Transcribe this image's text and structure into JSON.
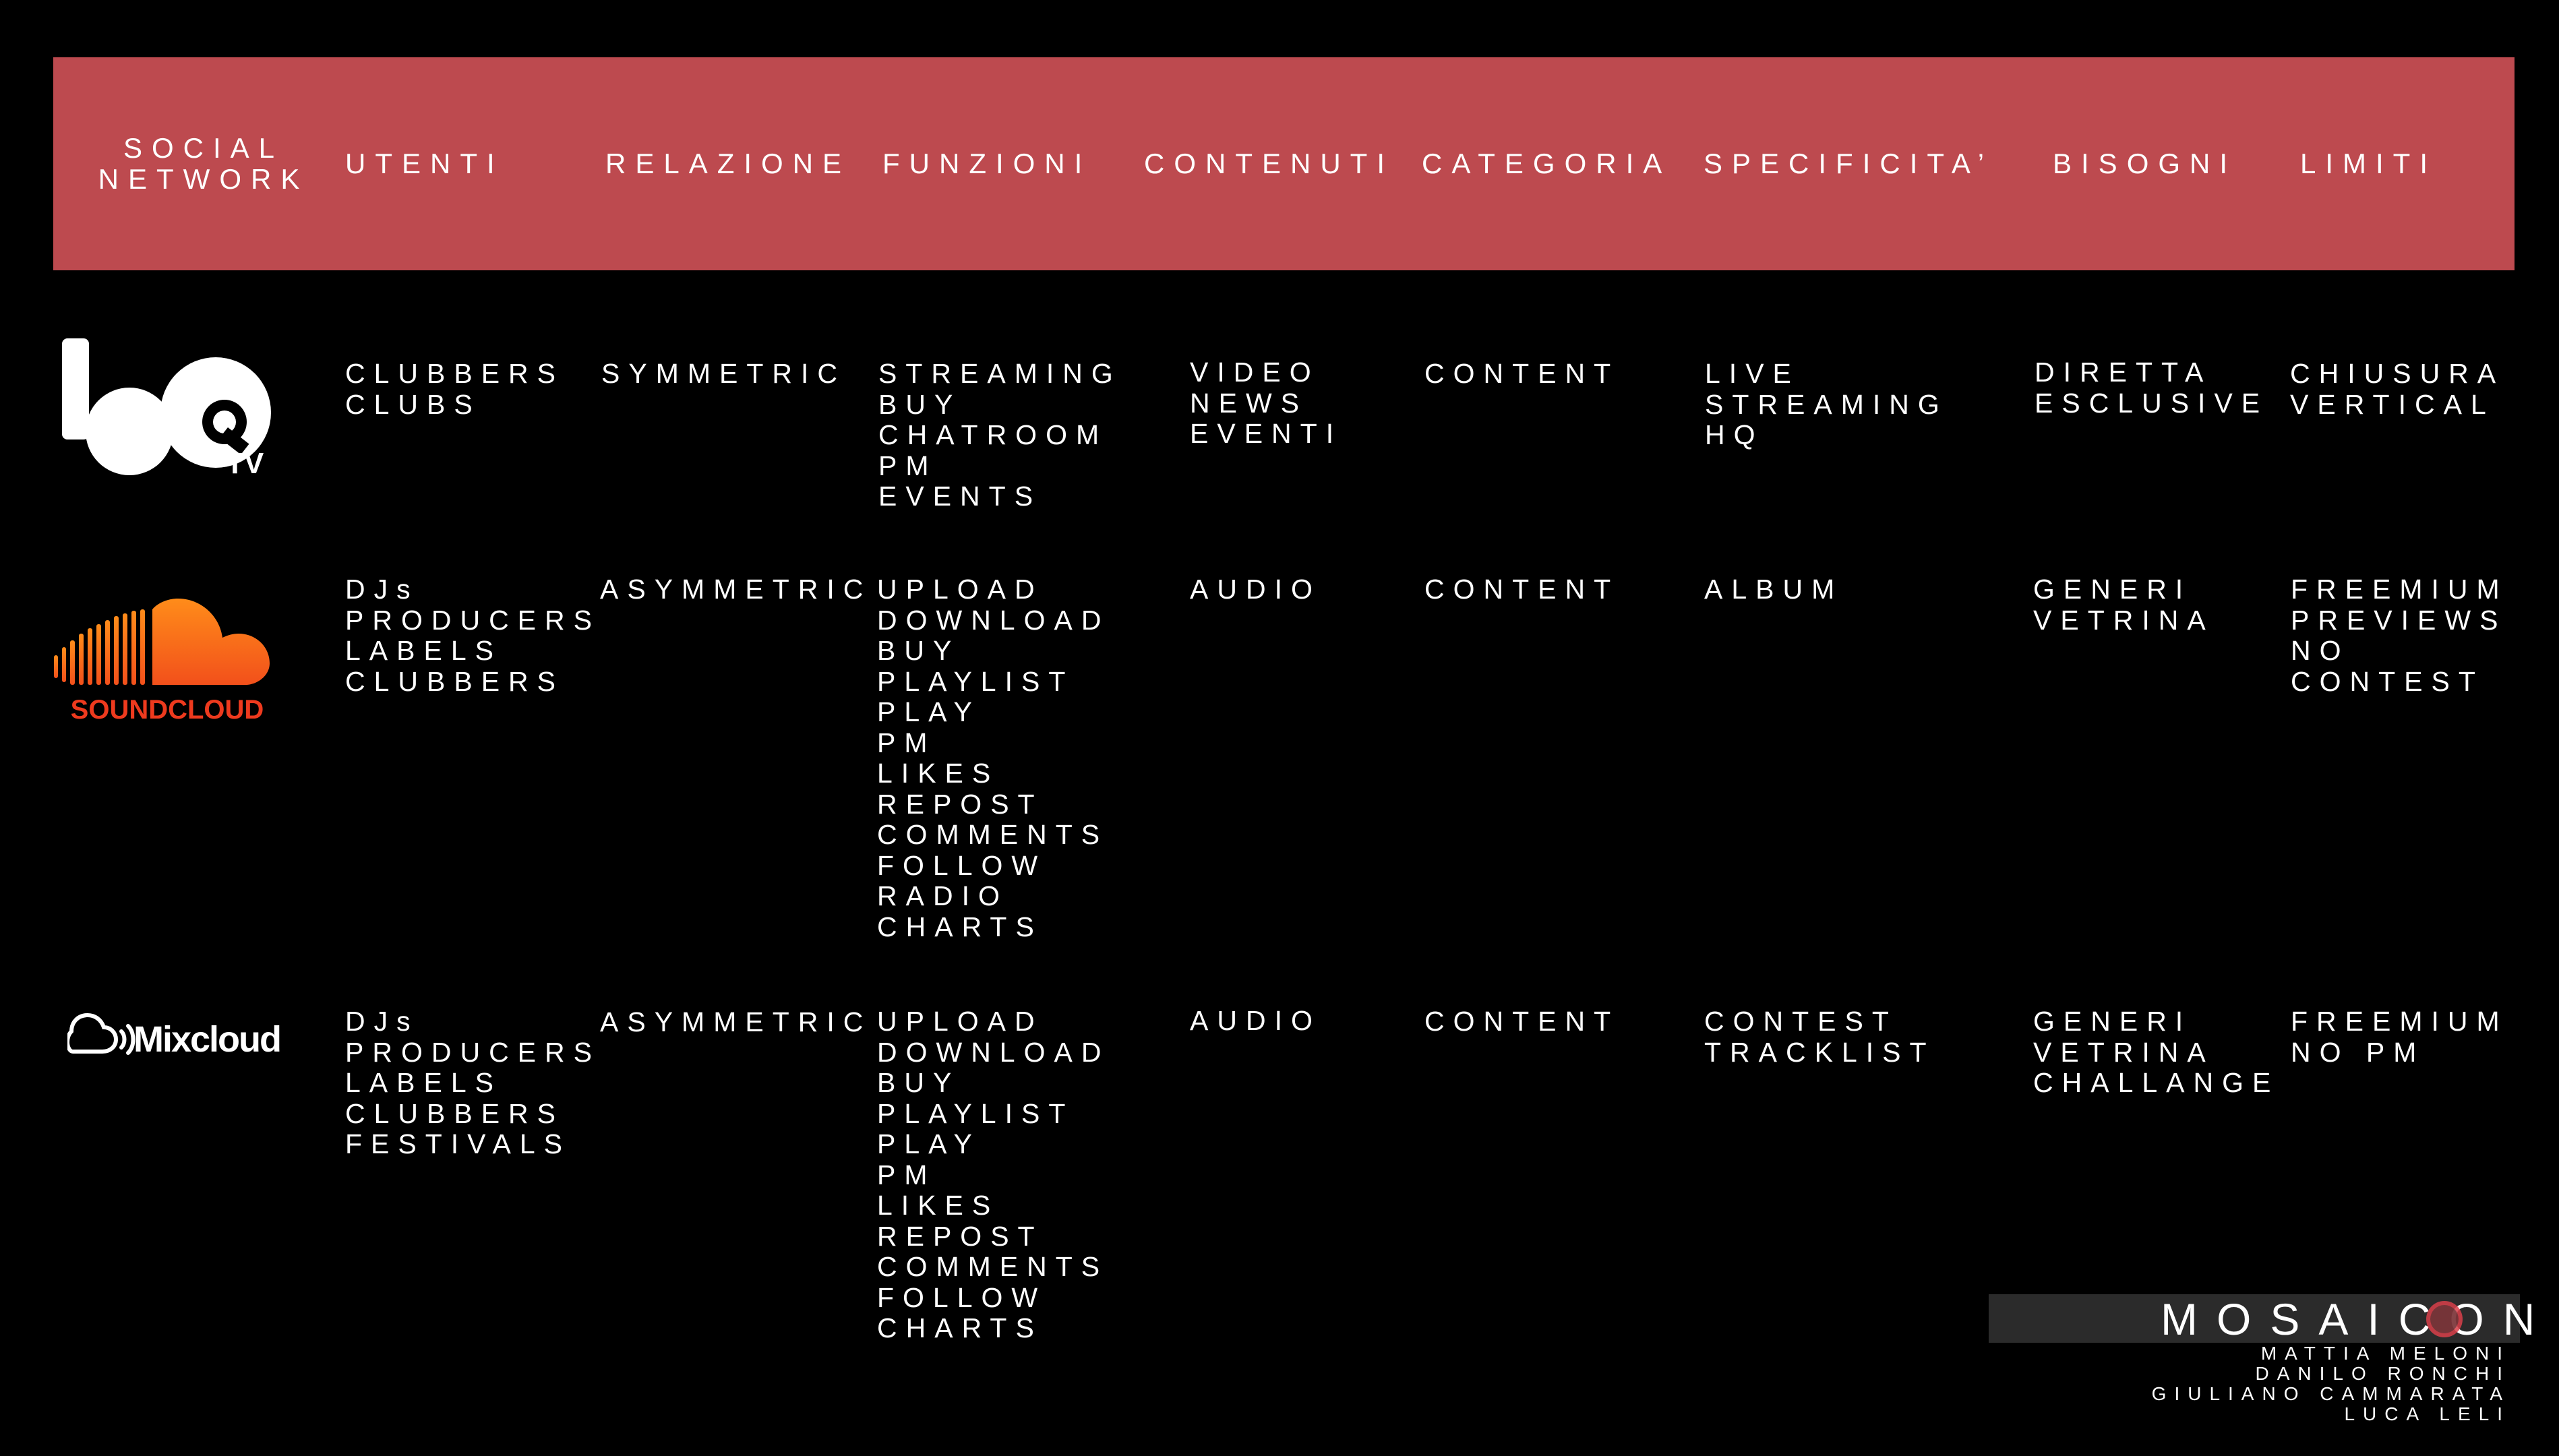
{
  "colors": {
    "background": "#000000",
    "header": "#bd4a4f",
    "text": "#ffffff",
    "soundcloud": "#f26b1b",
    "brand_bar": "#2b2b2b"
  },
  "header": {
    "columns": [
      "SOCIAL\nNETWORK",
      "UTENTI",
      "RELAZIONE",
      "FUNZIONI",
      "CONTENUTI",
      "CATEGORIA",
      "SPECIFICITA’",
      "BISOGNI",
      "LIMITI"
    ]
  },
  "rows": [
    {
      "logo": {
        "name": "bq-tv-logo",
        "text": "TV"
      },
      "utenti": "CLUBBERS\nCLUBS",
      "relazione": "SYMMETRIC",
      "funzioni": "STREAMING\nBUY\nCHATROOM\nPM\nEVENTS",
      "contenuti": "VIDEO\nNEWS\nEVENTI",
      "categoria": "CONTENT",
      "specificita": "LIVE\nSTREAMING\nHQ",
      "bisogni": "DIRETTA\nESCLUSIVE",
      "limiti": "CHIUSURA\nVERTICAL"
    },
    {
      "logo": {
        "name": "soundcloud-logo",
        "text": "SOUNDCLOUD"
      },
      "utenti": "DJs\nPRODUCERS\nLABELS\nCLUBBERS",
      "relazione": "ASYMMETRIC",
      "funzioni": "UPLOAD\nDOWNLOAD\nBUY\nPLAYLIST\nPLAY\nPM\nLIKES\nREPOST\nCOMMENTS\nFOLLOW\nRADIO\nCHARTS",
      "contenuti": "AUDIO",
      "categoria": "CONTENT",
      "specificita": "ALBUM",
      "bisogni": "GENERI\nVETRINA",
      "limiti": "FREEMIUM\nPREVIEWS\nNO CONTEST"
    },
    {
      "logo": {
        "name": "mixcloud-logo",
        "text": "Mixcloud"
      },
      "utenti": "DJs\nPRODUCERS\nLABELS\nCLUBBERS\nFESTIVALS",
      "relazione": "ASYMMETRIC",
      "funzioni": "UPLOAD\nDOWNLOAD\nBUY\nPLAYLIST\nPLAY\nPM\nLIKES\nREPOST\nCOMMENTS\nFOLLOW\nCHARTS",
      "contenuti": "AUDIO",
      "categoria": "CONTENT",
      "specificita": "CONTEST\nTRACKLIST",
      "bisogni": "GENERI\nVETRINA\nCHALLANGE",
      "limiti": "FREEMIUM\nNO PM"
    }
  ],
  "brand": {
    "name": "MOSAICON",
    "credits": "MATTIA MELONI\nDANILO RONCHI\nGIULIANO CAMMARATA\nLUCA LELI"
  }
}
